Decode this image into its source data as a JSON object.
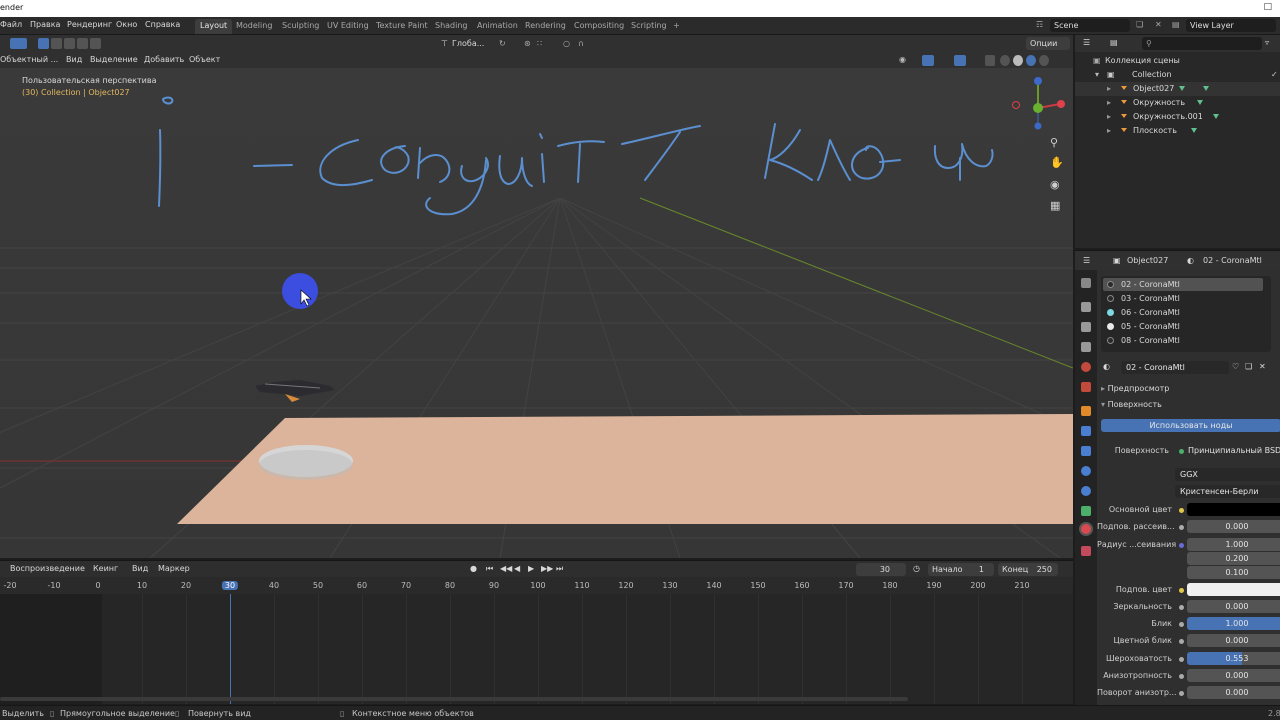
{
  "window": {
    "title": "ender"
  },
  "menubar": {
    "items": [
      "Файл",
      "Правка",
      "Рендеринг",
      "Окно",
      "Справка"
    ]
  },
  "workspaces": {
    "tabs": [
      "Layout",
      "Modeling",
      "Sculpting",
      "UV Editing",
      "Texture Paint",
      "Shading",
      "Animation",
      "Rendering",
      "Compositing",
      "Scripting"
    ],
    "active": "Layout",
    "add_label": "+"
  },
  "scene": {
    "scene_name": "Scene",
    "view_layer": "View Layer"
  },
  "viewport_header": {
    "orientation": "Глоба...",
    "options_label": "Опции"
  },
  "viewport_menu": {
    "mode": "Объектный ...",
    "items": [
      "Вид",
      "Выделение",
      "Добавить",
      "Объект"
    ]
  },
  "viewport": {
    "view_name": "Пользовательская перспектива",
    "collection_info": "(30) Collection | Object027",
    "colors": {
      "background": "#3a3a3a",
      "plane": "#dcb49b",
      "disc": "#dadada",
      "ink": "#5b8fd0",
      "cursor_dot": "#3c4ee0"
    }
  },
  "timeline": {
    "menus": [
      "Воспроизведение",
      "Кеинг",
      "Вид",
      "Маркер"
    ],
    "current_frame": "30",
    "start_label": "Начало",
    "start_value": "1",
    "end_label": "Конец",
    "end_value": "250",
    "ticks": [
      "-20",
      "-10",
      "0",
      "10",
      "20",
      "30",
      "40",
      "50",
      "60",
      "70",
      "80",
      "90",
      "100",
      "110",
      "120",
      "130",
      "140",
      "150",
      "160",
      "170",
      "180",
      "190",
      "200",
      "210"
    ]
  },
  "outliner": {
    "search_placeholder": "",
    "root": "Коллекция сцены",
    "collection": "Collection",
    "objects": [
      "Object027",
      "Окружность",
      "Окружность.001",
      "Плоскость"
    ]
  },
  "properties": {
    "object_name": "Object027",
    "material_name": "02 - CoronaMtl",
    "slots": [
      {
        "name": "02 - CoronaMtl",
        "color": "#2a2a2a"
      },
      {
        "name": "03 - CoronaMtl",
        "color": "#2a2a2a"
      },
      {
        "name": "06 - CoronaMtl",
        "color": "#7fd8e0"
      },
      {
        "name": "05 - CoronaMtl",
        "color": "#e8e8e8"
      },
      {
        "name": "08 - CoronaMtl",
        "color": "#2a2a2a"
      }
    ],
    "sections": {
      "preview": "Предпросмотр",
      "surface": "Поверхность"
    },
    "use_nodes_label": "Использовать ноды",
    "surface_label": "Поверхность",
    "surface_value": "Принципиальный BSDF",
    "distribution": "GGX",
    "subsurface_method": "Кристенсен-Берли",
    "rows": [
      {
        "label": "Основной цвет",
        "value": ""
      },
      {
        "label": "Подпов. рассеив...",
        "value": "0.000"
      },
      {
        "label": "Радиус ...сеивания",
        "value": "1.000"
      },
      {
        "label": "",
        "value": "0.200"
      },
      {
        "label": "",
        "value": "0.100"
      },
      {
        "label": "Подпов. цвет",
        "value": ""
      },
      {
        "label": "Зеркальность",
        "value": "0.000"
      },
      {
        "label": "Блик",
        "value": "1.000"
      },
      {
        "label": "Цветной блик",
        "value": "0.000"
      },
      {
        "label": "Шероховатость",
        "value": "0.553"
      },
      {
        "label": "Анизотропность",
        "value": "0.000"
      },
      {
        "label": "Поворот анизотр...",
        "value": "0.000"
      }
    ]
  },
  "statusbar": {
    "items": [
      "Выделить",
      "Прямоугольное выделение",
      "Повернуть вид",
      "Контекстное меню объектов"
    ],
    "version": "2.8"
  }
}
